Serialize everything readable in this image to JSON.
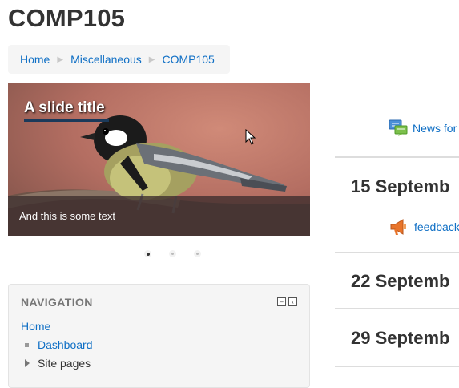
{
  "page": {
    "title": "COMP105"
  },
  "breadcrumb": {
    "items": [
      "Home",
      "Miscellaneous",
      "COMP105"
    ]
  },
  "slider": {
    "slide_title": "A slide title",
    "caption": "And this is some text",
    "slide_count": 3,
    "active_slide": 1
  },
  "navigation": {
    "header": "NAVIGATION",
    "home": "Home",
    "items": [
      {
        "label": "Dashboard",
        "type": "link"
      },
      {
        "label": "Site pages",
        "type": "expandable"
      }
    ]
  },
  "course": {
    "news_link": "News for",
    "weeks": [
      {
        "title": "15 Septemb",
        "activity": "feedback"
      },
      {
        "title": "22 Septemb"
      },
      {
        "title": "29 Septemb"
      }
    ]
  },
  "colors": {
    "link": "#0f6fc5",
    "text": "#333333",
    "muted": "#777777"
  },
  "icons": {
    "news": "forum-icon",
    "feedback": "megaphone-icon",
    "collapse": "minimize-icon",
    "dock": "dock-icon"
  }
}
